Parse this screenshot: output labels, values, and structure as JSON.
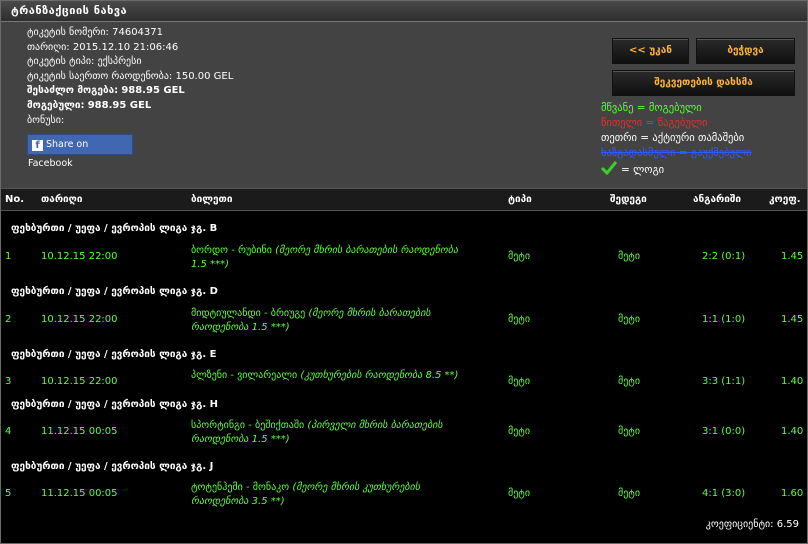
{
  "title": "ტრანზაქციის ნახვა",
  "ticket": [
    {
      "label": "ტიკეტის ნომერი:",
      "value": "74604371",
      "bold": false
    },
    {
      "label": "თარიღი:",
      "value": "2015.12.10 21:06:46",
      "bold": false
    },
    {
      "label": "ტიკეტის ტიპი:",
      "value": "ექსპრესი",
      "bold": false
    },
    {
      "label": "ტიკეტის საერთო რაოდენობა:",
      "value": "150.00 GEL",
      "bold": false
    },
    {
      "label": "შესაძლო მოგება:",
      "value": "988.95 GEL",
      "bold": true
    },
    {
      "label": "მოგებული:",
      "value": "988.95 GEL",
      "bold": true
    },
    {
      "label": "ბონუსი:",
      "value": "",
      "bold": false
    }
  ],
  "facebook_label": "Share on Facebook",
  "buttons": {
    "back": "<< უკან",
    "print": "ბეჭდვა",
    "repeat": "შეკვეთების დახსმა"
  },
  "legend": {
    "green": "მწვანე = მოგებული",
    "red": "წითელი = წაგებული",
    "white": "თეთრი = აქტიური თამაშები",
    "blue": "ხაზგადასმული = გაუქმებული",
    "check": "= ლოგი"
  },
  "columns": [
    "No.",
    "თარიღი",
    "ბილეთი",
    "ტიპი",
    "შედეგი",
    "ანგარიში",
    "კოეფ."
  ],
  "rows": [
    {
      "group": "ფეხბურთი / უეფა / ევროპის ლიგა ჯგ. B",
      "no": "1",
      "date": "10.12.15 22:00",
      "match": "ბორდო - რუბინი",
      "detail": "(მეორე მხრის ბარათების რაოდენობა 1.5 ***)",
      "type": "მეტი",
      "result": "მეტი",
      "score": "2:2 (0:1)",
      "odd": "1.45"
    },
    {
      "group": "ფეხბურთი / უეფა / ევროპის ლიგა ჯგ. D",
      "no": "2",
      "date": "10.12.15 22:00",
      "match": "მიდტიულანდი - ბრიუგე",
      "detail": "(მეორე მხრის ბარათების რაოდენობა 1.5 ***)",
      "type": "მეტი",
      "result": "მეტი",
      "score": "1:1 (1:0)",
      "odd": "1.45"
    },
    {
      "group": "ფეხბურთი / უეფა / ევროპის ლიგა ჯგ. E",
      "no": "3",
      "date": "10.12.15 22:00",
      "match": "პლზენი - ვილარეალი",
      "detail": "(კუთხურების რაოდენობა 8.5 **)",
      "type": "მეტი",
      "result": "მეტი",
      "score": "3:3 (1:1)",
      "odd": "1.40"
    },
    {
      "group": "ფეხბურთი / უეფა / ევროპის ლიგა ჯგ. H",
      "no": "4",
      "date": "11.12.15 00:05",
      "match": "სპორტინგი - ბეშიქთაში",
      "detail": "(პირველი მხრის ბარათების რაოდენობა 1.5 ***)",
      "type": "მეტი",
      "result": "მეტი",
      "score": "3:1 (0:0)",
      "odd": "1.40"
    },
    {
      "group": "ფეხბურთი / უეფა / ევროპის ლიგა ჯგ. J",
      "no": "5",
      "date": "11.12.15 00:05",
      "match": "ტოტენჰემი - მონაკო",
      "detail": "(მეორე მხრის კუთხურების რაოდენობა 3.5 **)",
      "type": "მეტი",
      "result": "მეტი",
      "score": "4:1 (3:0)",
      "odd": "1.60"
    }
  ],
  "total": "კოეფიციენტი: 6.59",
  "colors": {
    "win_green": "#5dff3a",
    "button_text": "#ffb340",
    "panel": "#434343"
  }
}
